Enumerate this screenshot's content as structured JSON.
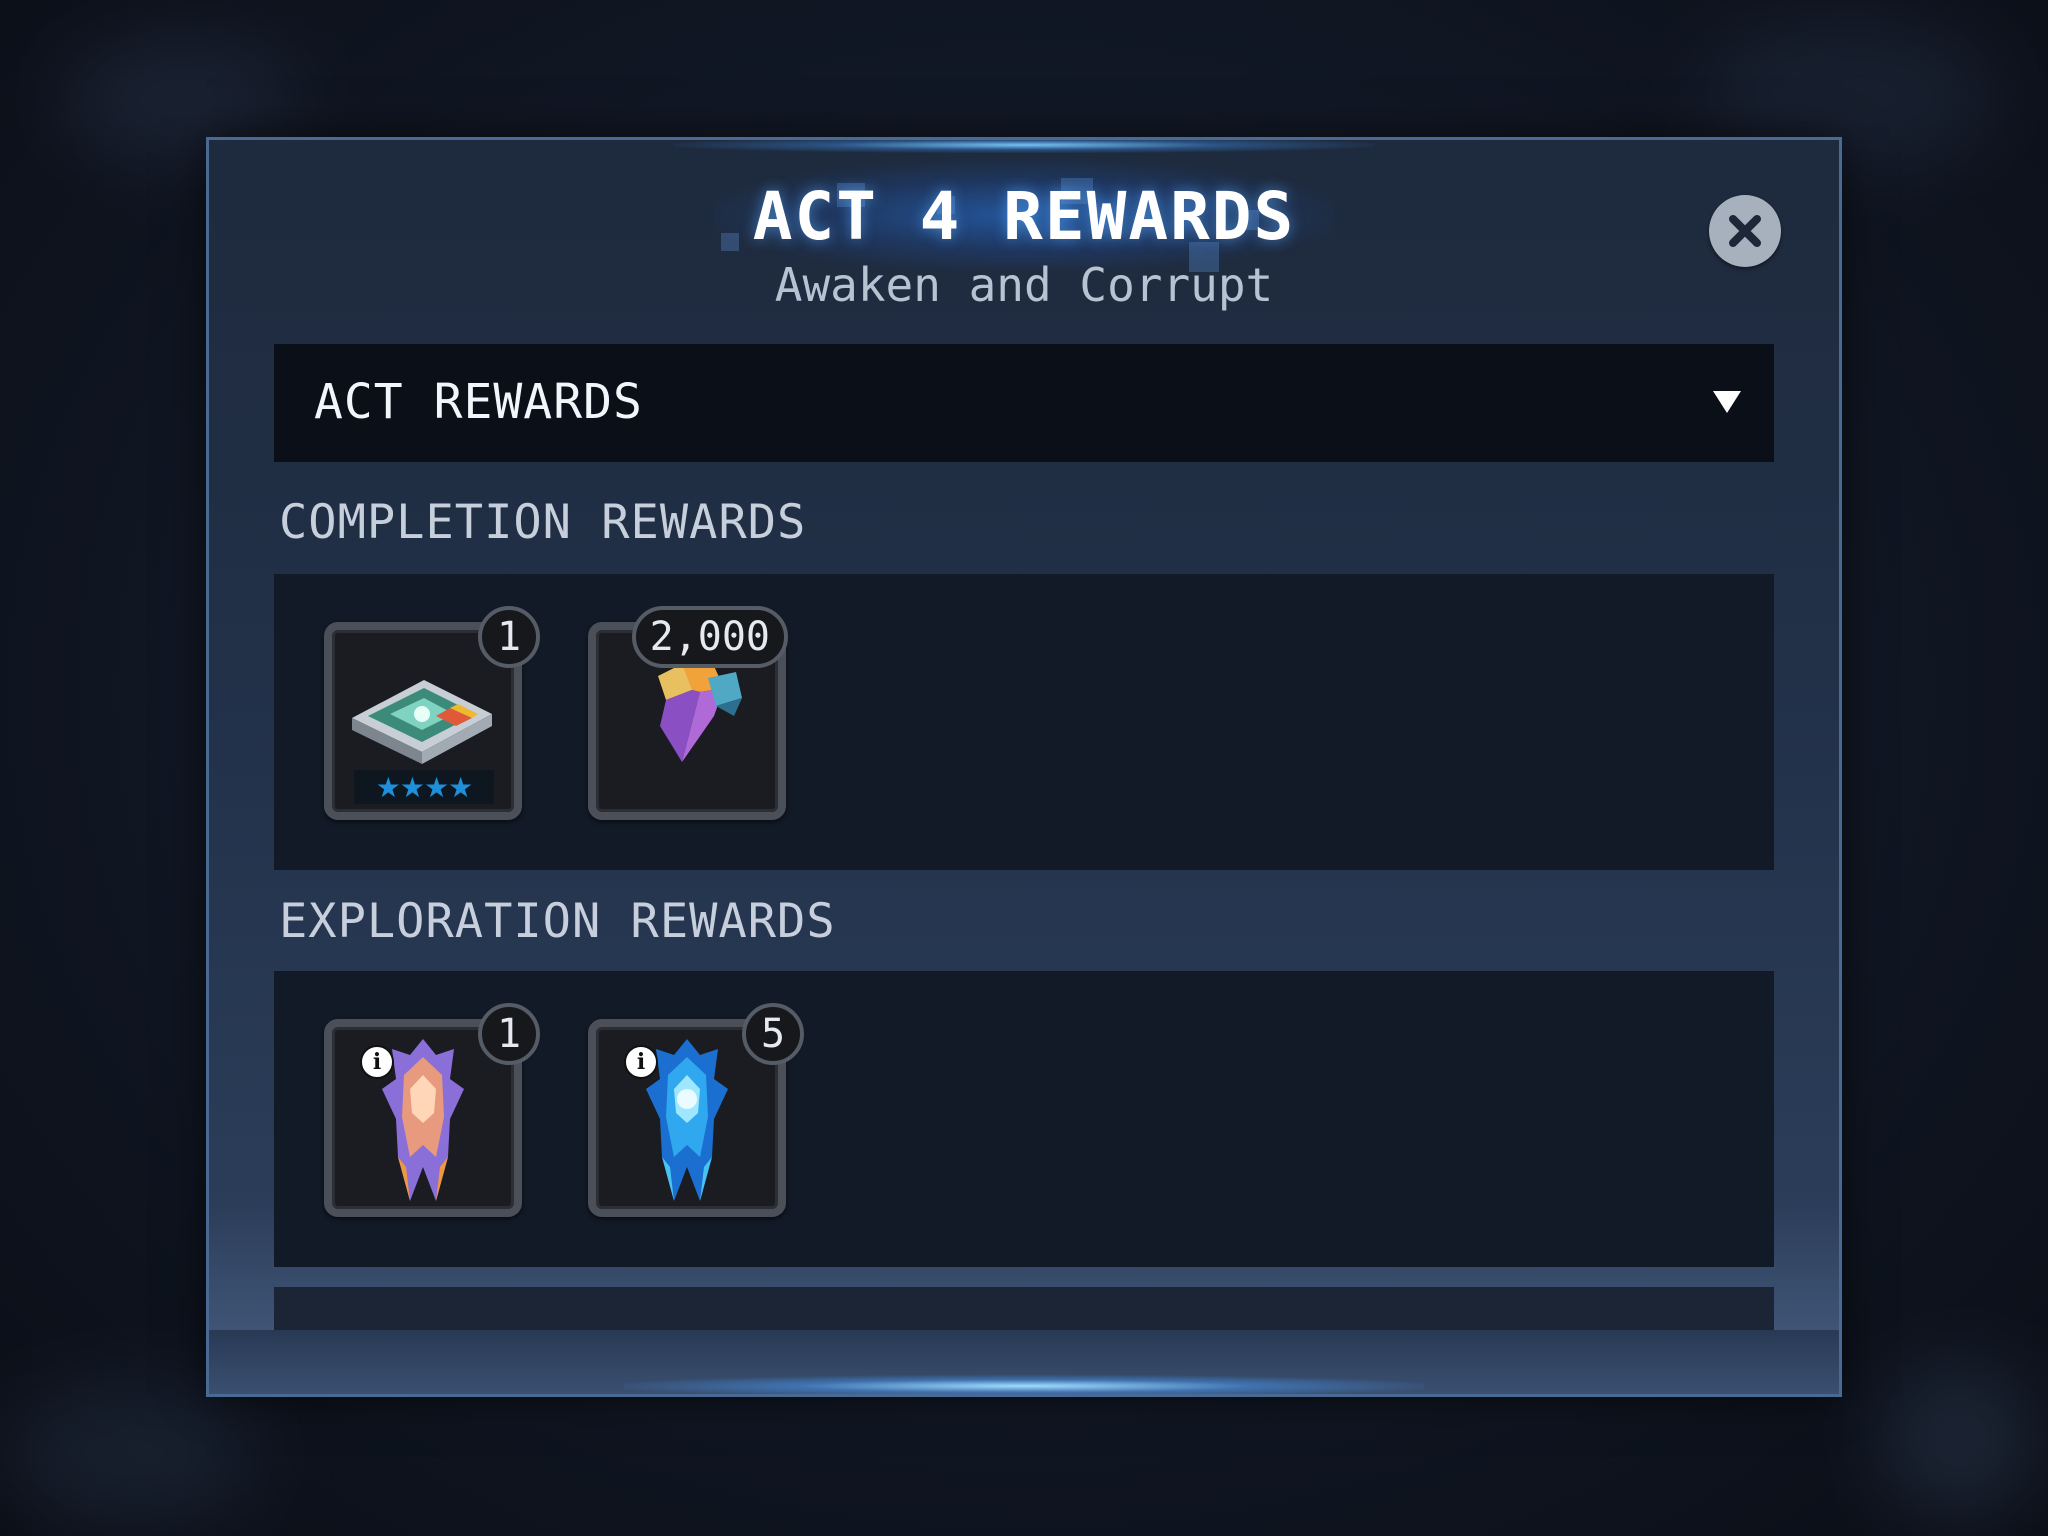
{
  "modal": {
    "title": "ACT 4 REWARDS",
    "subtitle": "Awaken and Corrupt",
    "close_icon": "close-icon"
  },
  "dropdown": {
    "label": "ACT REWARDS",
    "icon": "triangle-down-icon"
  },
  "sections": [
    {
      "label": "COMPLETION REWARDS",
      "items": [
        {
          "icon": "crystal-shard-card-icon",
          "count": "1",
          "stars": "★★★★"
        },
        {
          "icon": "gold-crystal-shard-icon",
          "count": "2,000"
        }
      ]
    },
    {
      "label": "EXPLORATION REWARDS",
      "items": [
        {
          "icon": "awakening-gem-icon",
          "count": "1",
          "info_icon": "info-icon"
        },
        {
          "icon": "blue-awakening-catalyst-icon",
          "count": "5",
          "info_icon": "info-icon"
        }
      ]
    }
  ],
  "colors": {
    "modal_border": "#4a6a94",
    "star_blue": "#1e8fd9",
    "dropdown_bg": "#0a0f18"
  }
}
